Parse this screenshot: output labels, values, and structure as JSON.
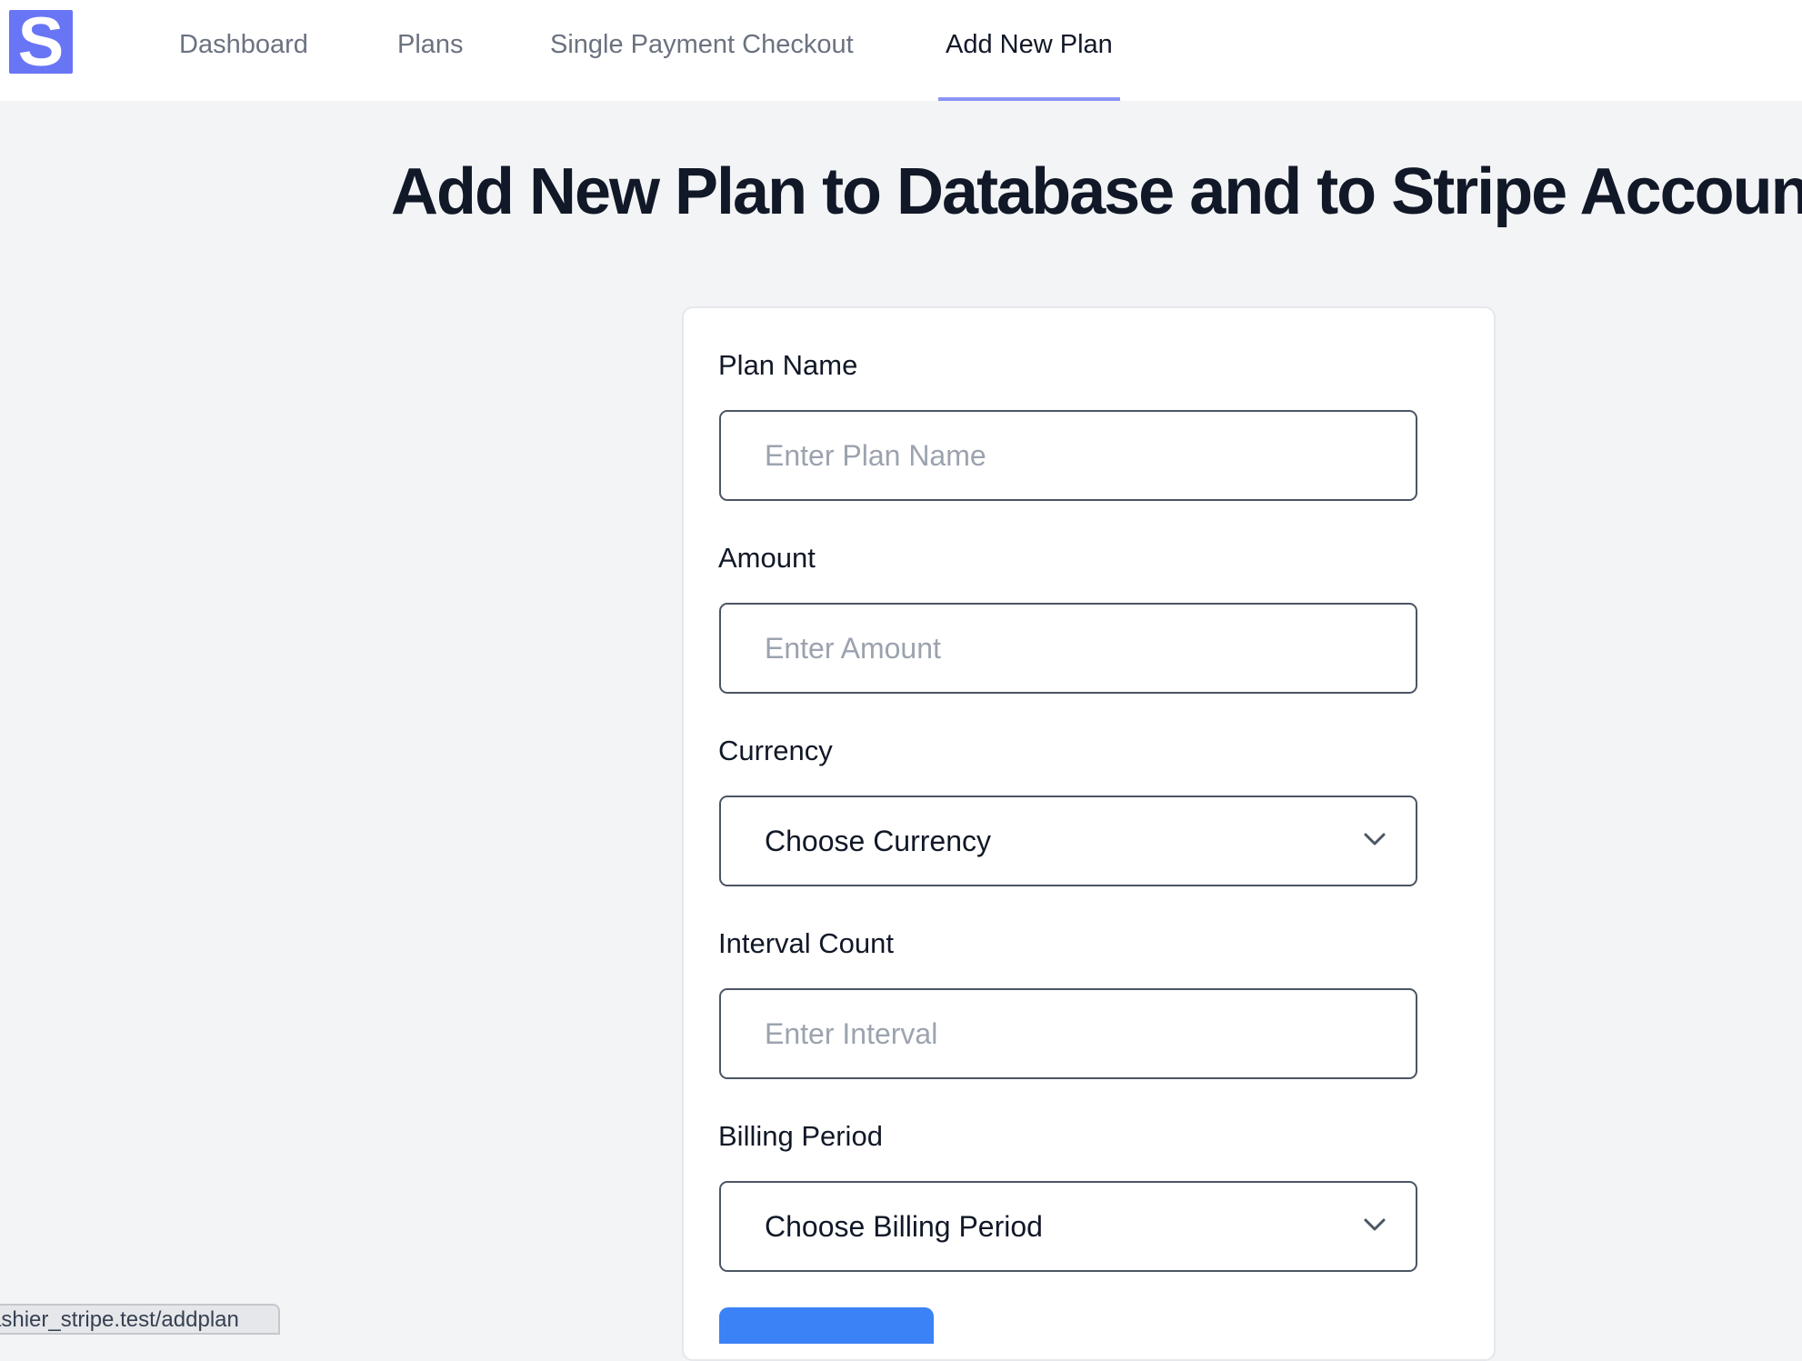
{
  "nav": {
    "logo_letter": "S",
    "items": [
      {
        "label": "Dashboard"
      },
      {
        "label": "Plans"
      },
      {
        "label": "Single Payment Checkout"
      },
      {
        "label": "Add New Plan",
        "active": true
      }
    ],
    "accent_color": "#6875f5"
  },
  "page": {
    "title": "Add New Plan to Database and to Stripe Account"
  },
  "form": {
    "plan_name": {
      "label": "Plan Name",
      "placeholder": "Enter Plan Name",
      "value": ""
    },
    "amount": {
      "label": "Amount",
      "placeholder": "Enter Amount",
      "value": ""
    },
    "currency": {
      "label": "Currency",
      "selected": "Choose Currency"
    },
    "interval_count": {
      "label": "Interval Count",
      "placeholder": "Enter Interval",
      "value": ""
    },
    "billing_period": {
      "label": "Billing Period",
      "selected": "Choose Billing Period"
    },
    "submit_color": "#3b82f6"
  },
  "status_bar": {
    "url": "ashier_stripe.test/addplan"
  }
}
